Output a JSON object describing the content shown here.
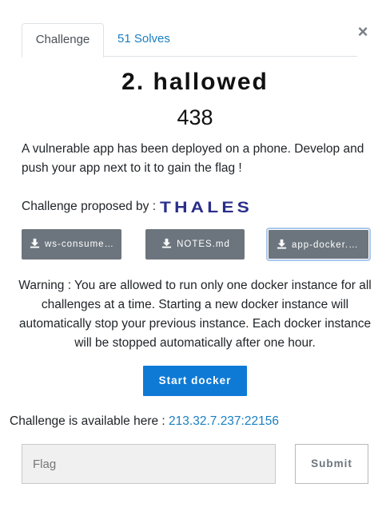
{
  "modal": {
    "close_label": "×",
    "tabs": [
      {
        "label": "Challenge"
      },
      {
        "label": "51 Solves"
      }
    ],
    "title": "2. hallowed",
    "points": "438",
    "description": "A vulnerable app has been deployed on a phone. Develop and push your app next to it to gain the flag !",
    "proposed_by_label": "Challenge proposed by :",
    "proposer_logo_text": "THALES",
    "files": [
      {
        "label": "ws-consume…",
        "icon": "download-icon"
      },
      {
        "label": "NOTES.md",
        "icon": "download-icon"
      },
      {
        "label": "app-docker.a…",
        "icon": "download-icon"
      }
    ],
    "warning": "Warning : You are allowed to run only one docker instance for all challenges at a time. Starting a new docker instance will automatically stop your previous instance. Each docker instance will be stopped automatically after one hour.",
    "start_docker_label": "Start docker",
    "available_label": "Challenge is available here :",
    "available_link": "213.32.7.237:22156",
    "flag_placeholder": "Flag",
    "submit_label": "Submit"
  },
  "colors": {
    "accent": "#0e7ad6",
    "link": "#1a7fc1",
    "file_button": "#6c757d",
    "logo": "#2a2e8a"
  }
}
